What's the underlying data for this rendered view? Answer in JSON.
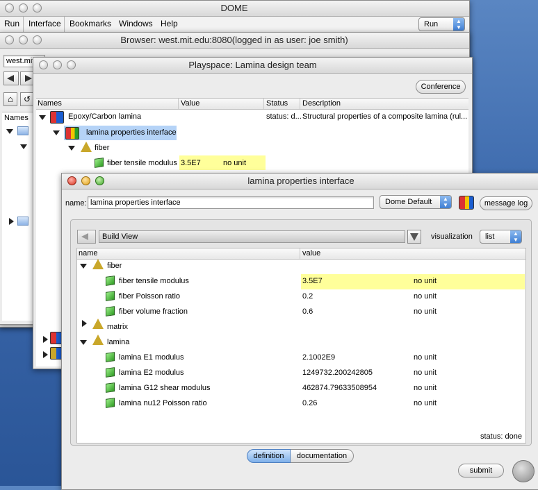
{
  "dome": {
    "title": "DOME",
    "menu": [
      "Run",
      "Interface",
      "Bookmarks",
      "Windows",
      "Help"
    ],
    "run_select": "Run"
  },
  "browser": {
    "title": "Browser: west.mit.edu:8080(logged in as user: joe smith)",
    "address": "west.mit",
    "names_header": "Names"
  },
  "playspace": {
    "title": "Playspace: Lamina design team",
    "conference_label": "Conference",
    "columns": [
      "Names",
      "Value",
      "Status",
      "Description"
    ],
    "rows": [
      {
        "name": "Epoxy/Carbon lamina",
        "status": "status: d...",
        "description": "Structural properties of a composite lamina (rul..."
      },
      {
        "name": "lamina properties interface"
      },
      {
        "name": "fiber"
      },
      {
        "name": "fiber tensile modulus",
        "value": "3.5E7",
        "unit": "no unit"
      }
    ]
  },
  "interface": {
    "title": "lamina properties interface",
    "name_label": "name:",
    "name_value": "lamina properties interface",
    "dome_default": "Dome Default",
    "message_log": "message log",
    "build_view": "Build View",
    "visualization_label": "visualization",
    "visualization_value": "list",
    "columns": {
      "name": "name",
      "value": "value"
    },
    "groups": [
      {
        "name": "fiber",
        "expanded": true,
        "items": [
          {
            "name": "fiber tensile modulus",
            "value": "3.5E7",
            "unit": "no unit",
            "highlight": true
          },
          {
            "name": "fiber Poisson ratio",
            "value": "0.2",
            "unit": "no unit"
          },
          {
            "name": "fiber volume fraction",
            "value": "0.6",
            "unit": "no unit"
          }
        ]
      },
      {
        "name": "matrix",
        "expanded": false,
        "items": []
      },
      {
        "name": "lamina",
        "expanded": true,
        "items": [
          {
            "name": "lamina E1 modulus",
            "value": "2.1002E9",
            "unit": "no unit"
          },
          {
            "name": "lamina E2 modulus",
            "value": "1249732.200242805",
            "unit": "no unit"
          },
          {
            "name": "lamina G12 shear modulus",
            "value": "462874.79633508954",
            "unit": "no unit"
          },
          {
            "name": "lamina nu12 Poisson ratio",
            "value": "0.26",
            "unit": "no unit"
          }
        ]
      }
    ],
    "status": "status: done",
    "tabs": [
      "definition",
      "documentation"
    ],
    "active_tab": "definition",
    "submit_label": "submit"
  }
}
